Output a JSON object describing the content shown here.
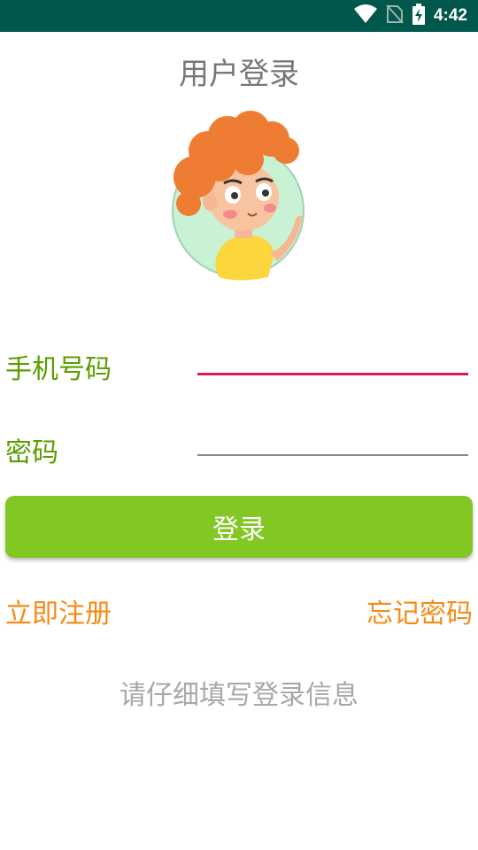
{
  "status_bar": {
    "time": "4:42",
    "icons": [
      "wifi-icon",
      "no-sim-icon",
      "battery-charging-icon"
    ],
    "background": "#00574b"
  },
  "title": "用户登录",
  "avatar": {
    "icon": "cartoon-boy-avatar-icon"
  },
  "form": {
    "phone_label": "手机号码",
    "phone_value": "",
    "password_label": "密码",
    "password_value": "",
    "focused_line_color": "#d81b60"
  },
  "login_button": {
    "label": "登录",
    "color": "#82c724"
  },
  "links": {
    "register": "立即注册",
    "forgot_password": "忘记密码",
    "color": "#f78a14"
  },
  "hint": "请仔细填写登录信息",
  "colors": {
    "label_green": "#5a9e00",
    "title_gray": "#777777",
    "hint_gray": "#a8a8a8"
  }
}
